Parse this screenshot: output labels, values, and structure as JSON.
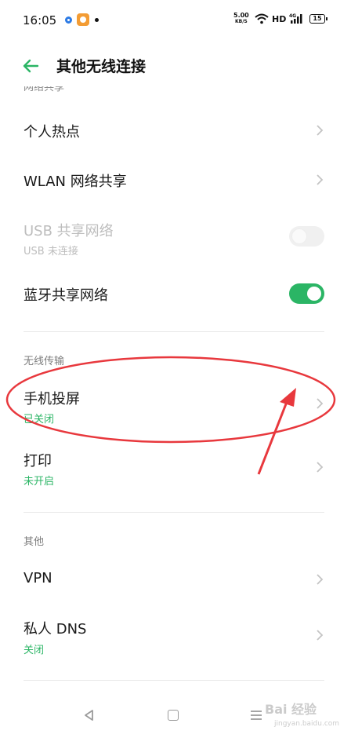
{
  "status_bar": {
    "time": "16:05",
    "net_speed_value": "5.00",
    "net_speed_unit": "KB/S",
    "hd": "HD",
    "network": "4G",
    "battery": "15"
  },
  "header": {
    "title": "其他无线连接"
  },
  "sections": {
    "network_sharing": {
      "header": "网络共享",
      "hotspot": "个人热点",
      "wlan_share": "WLAN 网络共享",
      "usb_share": "USB 共享网络",
      "usb_share_status": "USB 未连接",
      "bt_share": "蓝牙共享网络"
    },
    "wireless_transfer": {
      "header": "无线传输",
      "screen_cast": "手机投屏",
      "screen_cast_status": "已关闭",
      "print": "打印",
      "print_status": "未开启"
    },
    "other": {
      "header": "其他",
      "vpn": "VPN",
      "private_dns": "私人 DNS",
      "private_dns_status": "关闭"
    }
  },
  "toggles": {
    "usb_share": false,
    "bt_share": true
  },
  "watermark": {
    "text": "Bai 经验",
    "url": "jingyan.baidu.com"
  },
  "colors": {
    "accent": "#2bb565",
    "annotation": "#e8383d"
  }
}
